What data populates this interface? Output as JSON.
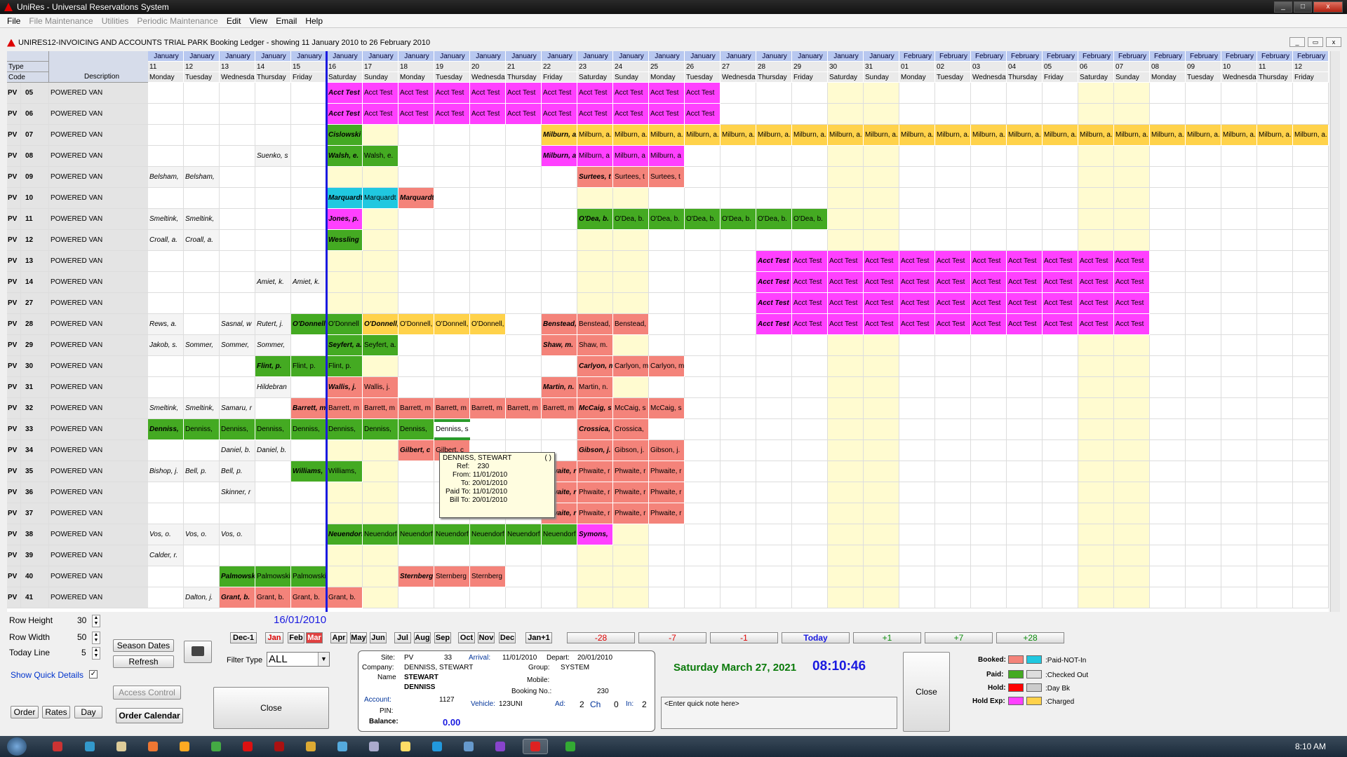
{
  "window": {
    "title": "UniRes - Universal Reservations System",
    "min": "_",
    "max": "□",
    "close": "x"
  },
  "menu": [
    {
      "label": "File",
      "dim": false
    },
    {
      "label": "File Maintenance",
      "dim": true
    },
    {
      "label": "Utilities",
      "dim": true
    },
    {
      "label": "Periodic Maintenance",
      "dim": true
    },
    {
      "label": "Edit",
      "dim": false
    },
    {
      "label": "View",
      "dim": false
    },
    {
      "label": "Email",
      "dim": false
    },
    {
      "label": "Help",
      "dim": false
    }
  ],
  "ledger": {
    "title": "UNIRES12-INVOICING AND ACCOUNTS TRIAL PARK Booking Ledger - showing 11 January 2010  to  26 February 2010"
  },
  "grid": {
    "left_headers": {
      "type": "Type",
      "code": "Code",
      "description": "Description"
    },
    "columns": [
      {
        "month": "January",
        "day": "11",
        "dow": "Monday"
      },
      {
        "month": "January",
        "day": "12",
        "dow": "Tuesday"
      },
      {
        "month": "January",
        "day": "13",
        "dow": "Wednesday"
      },
      {
        "month": "January",
        "day": "14",
        "dow": "Thursday"
      },
      {
        "month": "January",
        "day": "15",
        "dow": "Friday"
      },
      {
        "month": "January",
        "day": "16",
        "dow": "Saturday"
      },
      {
        "month": "January",
        "day": "17",
        "dow": "Sunday"
      },
      {
        "month": "January",
        "day": "18",
        "dow": "Monday"
      },
      {
        "month": "January",
        "day": "19",
        "dow": "Tuesday"
      },
      {
        "month": "January",
        "day": "20",
        "dow": "Wednesday"
      },
      {
        "month": "January",
        "day": "21",
        "dow": "Thursday"
      },
      {
        "month": "January",
        "day": "22",
        "dow": "Friday"
      },
      {
        "month": "January",
        "day": "23",
        "dow": "Saturday"
      },
      {
        "month": "January",
        "day": "24",
        "dow": "Sunday"
      },
      {
        "month": "January",
        "day": "25",
        "dow": "Monday"
      },
      {
        "month": "January",
        "day": "26",
        "dow": "Tuesday"
      },
      {
        "month": "January",
        "day": "27",
        "dow": "Wednesday"
      },
      {
        "month": "January",
        "day": "28",
        "dow": "Thursday"
      },
      {
        "month": "January",
        "day": "29",
        "dow": "Friday"
      },
      {
        "month": "January",
        "day": "30",
        "dow": "Saturday"
      },
      {
        "month": "January",
        "day": "31",
        "dow": "Sunday"
      },
      {
        "month": "February",
        "day": "01",
        "dow": "Monday"
      },
      {
        "month": "February",
        "day": "02",
        "dow": "Tuesday"
      },
      {
        "month": "February",
        "day": "03",
        "dow": "Wednesday"
      },
      {
        "month": "February",
        "day": "04",
        "dow": "Thursday"
      },
      {
        "month": "February",
        "day": "05",
        "dow": "Friday"
      },
      {
        "month": "February",
        "day": "06",
        "dow": "Saturday"
      },
      {
        "month": "February",
        "day": "07",
        "dow": "Sunday"
      },
      {
        "month": "February",
        "day": "08",
        "dow": "Monday"
      },
      {
        "month": "February",
        "day": "09",
        "dow": "Tuesday"
      },
      {
        "month": "February",
        "day": "10",
        "dow": "Wednesday"
      },
      {
        "month": "February",
        "day": "11",
        "dow": "Thursday"
      },
      {
        "month": "February",
        "day": "12",
        "dow": "Friday"
      }
    ],
    "rows": [
      {
        "type": "PV",
        "code": "05",
        "desc": "POWERED VAN",
        "bookings": [
          {
            "s": 5,
            "e": 15,
            "c": "pink",
            "t": "Acct Test"
          }
        ]
      },
      {
        "type": "PV",
        "code": "06",
        "desc": "POWERED VAN",
        "bookings": [
          {
            "s": 5,
            "e": 15,
            "c": "pink",
            "t": "Acct Test"
          }
        ]
      },
      {
        "type": "PV",
        "code": "07",
        "desc": "POWERED VAN",
        "bookings": [
          {
            "s": 5,
            "e": 5,
            "c": "green",
            "t": "Cislowski"
          },
          {
            "s": 11,
            "e": 32,
            "c": "yellow",
            "t": "Milburn, a."
          }
        ]
      },
      {
        "type": "PV",
        "code": "08",
        "desc": "POWERED VAN",
        "plain": [
          {
            "s": 3,
            "e": 3,
            "t": "Suenko, s"
          }
        ],
        "bookings": [
          {
            "s": 5,
            "e": 6,
            "c": "green",
            "t": "Walsh, e."
          },
          {
            "s": 11,
            "e": 14,
            "c": "pink",
            "t": "Milburn, a"
          }
        ]
      },
      {
        "type": "PV",
        "code": "09",
        "desc": "POWERED VAN",
        "plain": [
          {
            "s": 0,
            "e": 1,
            "t": "Belsham,"
          }
        ],
        "bookings": [
          {
            "s": 12,
            "e": 14,
            "c": "salmon",
            "t": "Surtees, t"
          }
        ]
      },
      {
        "type": "PV",
        "code": "10",
        "desc": "POWERED VAN",
        "bookings": [
          {
            "s": 5,
            "e": 6,
            "c": "cyan",
            "t": "Marquardt"
          },
          {
            "s": 7,
            "e": 7,
            "c": "salmon",
            "t": "Marquardt"
          }
        ]
      },
      {
        "type": "PV",
        "code": "11",
        "desc": "POWERED VAN",
        "plain": [
          {
            "s": 0,
            "e": 1,
            "t": "Smeltink,"
          }
        ],
        "bookings": [
          {
            "s": 5,
            "e": 5,
            "c": "pink",
            "t": "Jones, p."
          },
          {
            "s": 12,
            "e": 18,
            "c": "green",
            "t": "O'Dea, b."
          }
        ]
      },
      {
        "type": "PV",
        "code": "12",
        "desc": "POWERED VAN",
        "plain": [
          {
            "s": 0,
            "e": 1,
            "t": "Croall, a."
          }
        ],
        "bookings": [
          {
            "s": 5,
            "e": 5,
            "c": "green",
            "t": "Wessling"
          }
        ]
      },
      {
        "type": "PV",
        "code": "13",
        "desc": "POWERED VAN",
        "bookings": [
          {
            "s": 17,
            "e": 27,
            "c": "pink",
            "t": "Acct Test"
          }
        ]
      },
      {
        "type": "PV",
        "code": "14",
        "desc": "POWERED VAN",
        "plain": [
          {
            "s": 3,
            "e": 4,
            "t": "Amiet, k."
          }
        ],
        "bookings": [
          {
            "s": 17,
            "e": 27,
            "c": "pink",
            "t": "Acct Test"
          }
        ]
      },
      {
        "type": "PV",
        "code": "27",
        "desc": "POWERED VAN",
        "bookings": [
          {
            "s": 17,
            "e": 27,
            "c": "pink",
            "t": "Acct Test"
          }
        ]
      },
      {
        "type": "PV",
        "code": "28",
        "desc": "POWERED VAN",
        "plain": [
          {
            "s": 0,
            "e": 0,
            "t": "Rews, a."
          },
          {
            "s": 2,
            "e": 2,
            "t": "Sasnal, w"
          },
          {
            "s": 3,
            "e": 3,
            "t": "Rutert, j."
          }
        ],
        "bookings": [
          {
            "s": 4,
            "e": 5,
            "c": "green",
            "t": "O'Donnell"
          },
          {
            "s": 6,
            "e": 9,
            "c": "yellow",
            "t": "O'Donnell,"
          },
          {
            "s": 11,
            "e": 13,
            "c": "salmon",
            "t": "Benstead,"
          },
          {
            "s": 17,
            "e": 27,
            "c": "pink",
            "t": "Acct Test"
          }
        ]
      },
      {
        "type": "PV",
        "code": "29",
        "desc": "POWERED VAN",
        "plain": [
          {
            "s": 0,
            "e": 0,
            "t": "Jakob, s."
          },
          {
            "s": 1,
            "e": 3,
            "t": "Sommer,"
          }
        ],
        "bookings": [
          {
            "s": 5,
            "e": 6,
            "c": "green",
            "t": "Seyfert, a."
          },
          {
            "s": 11,
            "e": 12,
            "c": "salmon",
            "t": "Shaw, m."
          }
        ]
      },
      {
        "type": "PV",
        "code": "30",
        "desc": "POWERED VAN",
        "bookings": [
          {
            "s": 3,
            "e": 5,
            "c": "green",
            "t": "Flint, p."
          },
          {
            "s": 12,
            "e": 14,
            "c": "salmon",
            "t": "Carlyon, m"
          }
        ]
      },
      {
        "type": "PV",
        "code": "31",
        "desc": "POWERED VAN",
        "plain": [
          {
            "s": 3,
            "e": 3,
            "t": "Hildebran"
          }
        ],
        "bookings": [
          {
            "s": 5,
            "e": 6,
            "c": "salmon",
            "t": "Wallis, j."
          },
          {
            "s": 11,
            "e": 12,
            "c": "salmon",
            "t": "Martin, n."
          }
        ]
      },
      {
        "type": "PV",
        "code": "32",
        "desc": "POWERED VAN",
        "plain": [
          {
            "s": 0,
            "e": 1,
            "t": "Smeltink,"
          },
          {
            "s": 2,
            "e": 2,
            "t": "Samaru, r"
          }
        ],
        "bookings": [
          {
            "s": 4,
            "e": 11,
            "c": "salmon",
            "t": "Barrett, m"
          },
          {
            "s": 12,
            "e": 14,
            "c": "salmon",
            "t": "McCaig, s"
          }
        ]
      },
      {
        "type": "PV",
        "code": "33",
        "desc": "POWERED VAN",
        "bookings": [
          {
            "s": 0,
            "e": 7,
            "c": "green",
            "t": "Denniss,"
          },
          {
            "s": 12,
            "e": 13,
            "c": "salmon",
            "t": "Crossica,"
          }
        ],
        "selected": {
          "s": 8,
          "t": "Denniss, s"
        }
      },
      {
        "type": "PV",
        "code": "34",
        "desc": "POWERED VAN",
        "plain": [
          {
            "s": 2,
            "e": 3,
            "t": "Daniel, b."
          }
        ],
        "bookings": [
          {
            "s": 7,
            "e": 8,
            "c": "salmon",
            "t": "Gilbert, c"
          },
          {
            "s": 12,
            "e": 14,
            "c": "salmon",
            "t": "Gibson, j."
          }
        ]
      },
      {
        "type": "PV",
        "code": "35",
        "desc": "POWERED VAN",
        "plain": [
          {
            "s": 0,
            "e": 0,
            "t": "Bishop, j."
          },
          {
            "s": 1,
            "e": 1,
            "t": "Bell, p."
          },
          {
            "s": 2,
            "e": 2,
            "t": "Bell, p."
          }
        ],
        "bookings": [
          {
            "s": 4,
            "e": 5,
            "c": "green",
            "t": "Williams,"
          },
          {
            "s": 11,
            "e": 14,
            "c": "salmon",
            "t": "Phwaite, r"
          }
        ]
      },
      {
        "type": "PV",
        "code": "36",
        "desc": "POWERED VAN",
        "plain": [
          {
            "s": 2,
            "e": 2,
            "t": "Skinner, r"
          }
        ],
        "bookings": [
          {
            "s": 11,
            "e": 14,
            "c": "salmon",
            "t": "Phwaite, r"
          }
        ]
      },
      {
        "type": "PV",
        "code": "37",
        "desc": "POWERED VAN",
        "bookings": [
          {
            "s": 11,
            "e": 14,
            "c": "salmon",
            "t": "Phwaite, r"
          }
        ]
      },
      {
        "type": "PV",
        "code": "38",
        "desc": "POWERED VAN",
        "plain": [
          {
            "s": 0,
            "e": 0,
            "t": "Vos, o."
          },
          {
            "s": 1,
            "e": 1,
            "t": "Vos, o."
          },
          {
            "s": 2,
            "e": 2,
            "t": "Vos, o."
          }
        ],
        "bookings": [
          {
            "s": 5,
            "e": 11,
            "c": "green",
            "t": "Neuendorf"
          },
          {
            "s": 12,
            "e": 12,
            "c": "pink",
            "t": "Symons,"
          }
        ]
      },
      {
        "type": "PV",
        "code": "39",
        "desc": "POWERED VAN",
        "plain": [
          {
            "s": 0,
            "e": 0,
            "t": "Calder, r."
          }
        ],
        "bookings": []
      },
      {
        "type": "PV",
        "code": "40",
        "desc": "POWERED VAN",
        "bookings": [
          {
            "s": 2,
            "e": 4,
            "c": "green",
            "t": "Palmowski"
          },
          {
            "s": 7,
            "e": 9,
            "c": "salmon",
            "t": "Sternberg"
          }
        ]
      },
      {
        "type": "PV",
        "code": "41",
        "desc": "POWERED VAN",
        "plain": [
          {
            "s": 1,
            "e": 1,
            "t": "Dalton, j."
          }
        ],
        "bookings": [
          {
            "s": 2,
            "e": 5,
            "c": "salmon",
            "t": "Grant, b."
          }
        ]
      }
    ]
  },
  "tooltip": {
    "name": "DENNISS, STEWART",
    "paren": "( )",
    "ref_label": "Ref:",
    "ref": "230",
    "from_label": "From:",
    "from": "11/01/2010",
    "to_label": "To:",
    "to": "20/01/2010",
    "paid_label": "Paid To:",
    "paid": "11/01/2010",
    "bill_label": "Bill To:",
    "bill": "20/01/2010"
  },
  "controls": {
    "row_height_label": "Row Height",
    "row_height": "30",
    "row_width_label": "Row Width",
    "row_width": "50",
    "today_line_label": "Today Line",
    "today_line": "5",
    "show_quick_details": "Show Quick Details",
    "season_dates": "Season Dates",
    "refresh": "Refresh",
    "filter_type_label": "Filter Type",
    "filter_type": "ALL",
    "access_control": "Access Control",
    "order_calendar": "Order Calendar",
    "order": "Order",
    "rates": "Rates",
    "day": "Day",
    "close": "Close",
    "close2": "Close",
    "current_date": "16/01/2010"
  },
  "months": [
    "Dec-1",
    "Jan",
    "Feb",
    "Mar",
    "Apr",
    "May",
    "Jun",
    "Jul",
    "Aug",
    "Sep",
    "Oct",
    "Nov",
    "Dec",
    "Jan+1"
  ],
  "nav": [
    "-28",
    "-7",
    "-1",
    "Today",
    "+1",
    "+7",
    "+28"
  ],
  "info": {
    "site_label": "Site:",
    "site_type": "PV",
    "site_code": "33",
    "arrival_label": "Arrival:",
    "arrival": "11/01/2010",
    "depart_label": "Depart:",
    "depart": "20/01/2010",
    "company_label": "Company:",
    "company": "DENNISS, STEWART",
    "group_label": "Group:",
    "group": "SYSTEM",
    "name_label": "Name",
    "first": "STEWART",
    "last": "DENNISS",
    "mobile_label": "Mobile:",
    "booking_label": "Booking No.:",
    "booking": "230",
    "account_label": "Account:",
    "account": "1127",
    "pin_label": "PIN:",
    "vehicle_label": "Vehicle:",
    "vehicle": "123UNI",
    "ad_label": "Ad:",
    "ad": "2",
    "ch_label": "Ch",
    "ch": "0",
    "in_label": "In:",
    "in": "2",
    "balance_label": "Balance:",
    "balance": "0.00"
  },
  "clock": {
    "date": "Saturday March 27, 2021",
    "time": "08:10:46"
  },
  "note_placeholder": "<Enter quick note here>",
  "legend": {
    "booked": "Booked:",
    "paid_not_in": ":Paid-NOT-In",
    "paid": "Paid:",
    "checked_out": ":Checked Out",
    "hold": "Hold:",
    "day_bk": ":Day Bk",
    "hold_exp": "Hold Exp:",
    "charged": ":Charged"
  },
  "colors": {
    "pink": "#ff40ff",
    "green": "#44aa22",
    "yellow": "#ffd24a",
    "salmon": "#f4837a",
    "cyan": "#20c8e0",
    "weekend": "#fffbd0",
    "today": "#1a1ae0"
  },
  "taskbar": {
    "time": "8:10 AM"
  }
}
